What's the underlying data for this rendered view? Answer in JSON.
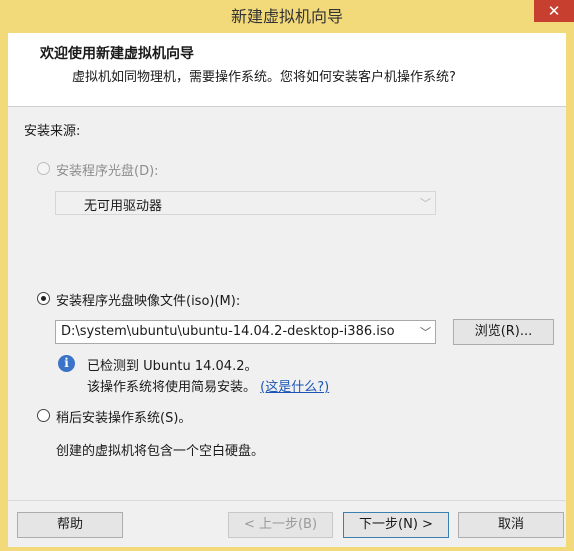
{
  "window": {
    "title": "新建虚拟机向导",
    "close_glyph": "✕"
  },
  "header": {
    "title": "欢迎使用新建虚拟机向导",
    "subtitle": "虚拟机如同物理机，需要操作系统。您将如何安装客户机操作系统?"
  },
  "source": {
    "label": "安装来源:",
    "disc": {
      "label": "安装程序光盘(D):",
      "selected": false,
      "enabled": false,
      "drive_value": "无可用驱动器"
    },
    "iso": {
      "label": "安装程序光盘映像文件(iso)(M):",
      "selected": true,
      "path": "D:\\system\\ubuntu\\ubuntu-14.04.2-desktop-i386.iso",
      "browse_label": "浏览(R)..."
    },
    "detect": {
      "line1": "已检测到 Ubuntu 14.04.2。",
      "line2": "该操作系统将使用简易安装。",
      "link": "(这是什么?)",
      "icon": "info-icon"
    },
    "later": {
      "label": "稍后安装操作系统(S)。",
      "selected": false,
      "description": "创建的虚拟机将包含一个空白硬盘。"
    }
  },
  "buttons": {
    "help": "帮助",
    "back": "< 上一步(B)",
    "next": "下一步(N) >",
    "cancel": "取消"
  },
  "colors": {
    "title_bar": "#f2d97a",
    "close": "#c7402f",
    "link": "#1a55b5",
    "info": "#3a73c8"
  }
}
